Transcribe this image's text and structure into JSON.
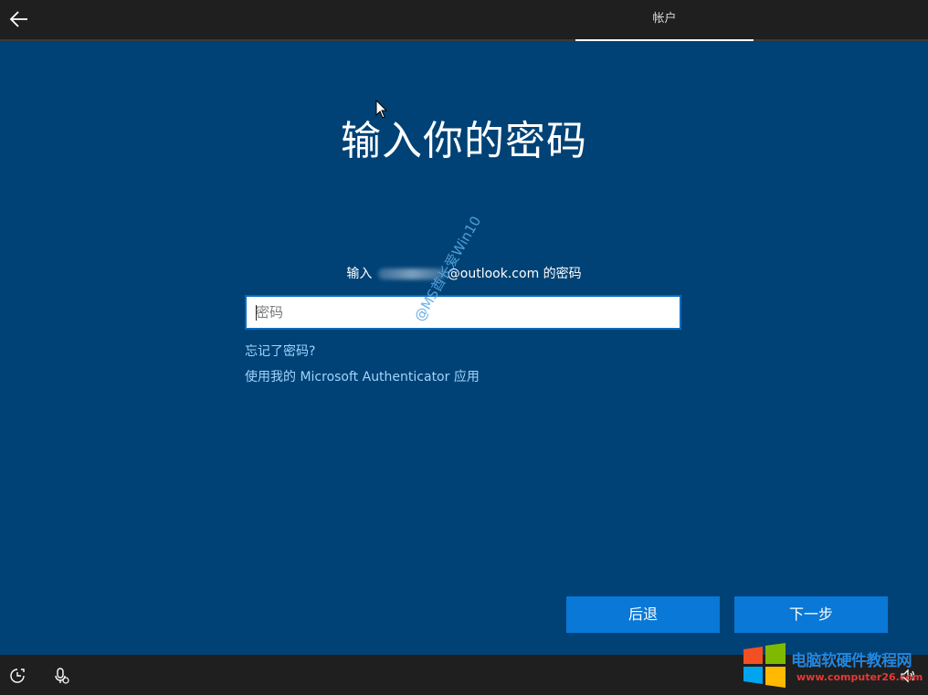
{
  "header": {
    "tab_label": "帐户"
  },
  "main": {
    "title": "输入你的密码",
    "prompt_before": "输入",
    "prompt_after": "@outlook.com 的密码",
    "password_placeholder": "密码",
    "forgot_link": "忘记了密码?",
    "authenticator_link": "使用我的 Microsoft Authenticator 应用",
    "watermark": "@MS酋长爱Win10"
  },
  "buttons": {
    "back_label": "后退",
    "next_label": "下一步"
  },
  "site_logo": {
    "name": "电脑软硬件教程网",
    "url": "www.computer26.com"
  },
  "colors": {
    "background": "#004275",
    "accent_button": "#0a78d6",
    "link": "#9fd4ff",
    "bar": "#1f1f1f"
  },
  "icons": [
    "back-arrow-icon",
    "ease-of-access-icon",
    "microphone-icon",
    "volume-icon",
    "windows-logo-icon"
  ]
}
